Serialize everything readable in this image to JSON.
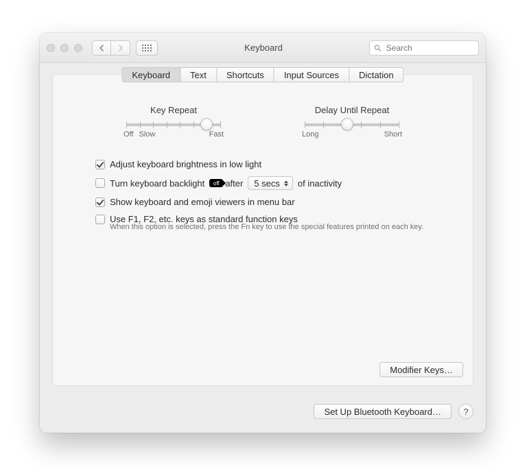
{
  "window": {
    "title": "Keyboard"
  },
  "search": {
    "placeholder": "Search"
  },
  "tabs": [
    {
      "label": "Keyboard",
      "active": true
    },
    {
      "label": "Text",
      "active": false
    },
    {
      "label": "Shortcuts",
      "active": false
    },
    {
      "label": "Input Sources",
      "active": false
    },
    {
      "label": "Dictation",
      "active": false
    }
  ],
  "sliders": {
    "keyRepeat": {
      "label": "Key Repeat",
      "left": "Off",
      "leftInner": "Slow",
      "right": "Fast",
      "ticks": 8,
      "position": 85
    },
    "delay": {
      "label": "Delay Until Repeat",
      "left": "Long",
      "right": "Short",
      "ticks": 6,
      "position": 45
    }
  },
  "options": {
    "brightness": {
      "label": "Adjust keyboard brightness in low light",
      "checked": true
    },
    "backlight": {
      "pre": "Turn keyboard backlight",
      "mid": "after",
      "value": "5 secs",
      "post": "of inactivity",
      "checked": false
    },
    "emoji": {
      "label": "Show keyboard and emoji viewers in menu bar",
      "checked": true
    },
    "fkeys": {
      "label": "Use F1, F2, etc. keys as standard function keys",
      "hint": "When this option is selected, press the Fn key to use the special features printed on each key.",
      "checked": false
    }
  },
  "buttons": {
    "modifier": "Modifier Keys…",
    "bluetooth": "Set Up Bluetooth Keyboard…",
    "help": "?"
  }
}
